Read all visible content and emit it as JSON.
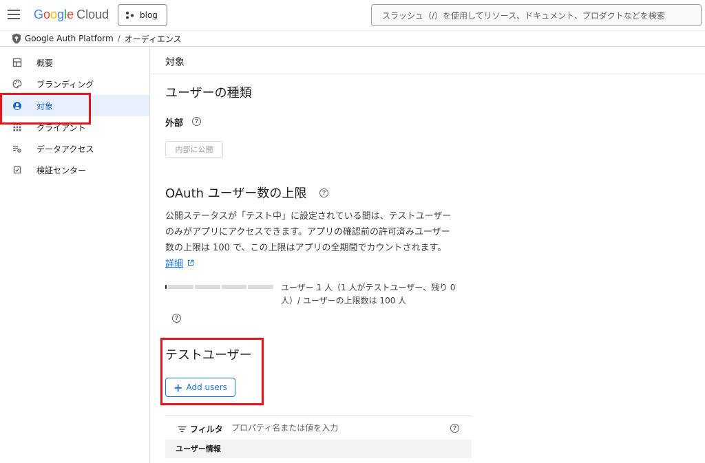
{
  "header": {
    "logo_parts": [
      "G",
      "o",
      "o",
      "g",
      "l",
      "e"
    ],
    "logo_suffix": "Cloud",
    "project": "blog",
    "search_placeholder": "スラッシュ（/）を使用してリソース、ドキュメント、プロダクトなどを検索"
  },
  "breadcrumb": {
    "product": "Google Auth Platform",
    "separator": "/",
    "page": "オーディエンス"
  },
  "sidebar": {
    "items": [
      {
        "label": "概要",
        "icon": "dashboard-icon"
      },
      {
        "label": "ブランディング",
        "icon": "palette-icon"
      },
      {
        "label": "対象",
        "icon": "account-circle-icon",
        "active": true
      },
      {
        "label": "クライアント",
        "icon": "apps-grid-icon"
      },
      {
        "label": "データアクセス",
        "icon": "data-settings-icon"
      },
      {
        "label": "検証センター",
        "icon": "checkbox-icon"
      }
    ]
  },
  "main": {
    "page_title": "対象",
    "user_type": {
      "heading": "ユーザーの種類",
      "type_label": "外部",
      "button_label": "内部に公開"
    },
    "oauth": {
      "heading": "OAuth ユーザー数の上限",
      "description_lines": [
        "公開ステータスが「テスト中」に設定されている間は、テストユーザー",
        "のみがアプリにアクセスできます。アプリの確認前の許可済みユーザー",
        "数の上限は 100 で、この上限はアプリの全期間でカウントされます。"
      ],
      "link": "詳細",
      "usage_line1": "ユーザー 1 人（1 人がテストユーザー、残り 0",
      "usage_line2": "人）/ ユーザーの上限数は 100 人",
      "usage_fraction": 0.01
    },
    "test_users": {
      "heading": "テストユーザー",
      "add_button": "Add users",
      "filter_label": "フィルタ",
      "filter_placeholder": "プロパティ名または値を入力",
      "column_header": "ユーザー情報"
    }
  },
  "colors": {
    "accent": "#1a73e8",
    "active_bg": "#e8f0fe",
    "highlight": "#e8141c"
  }
}
